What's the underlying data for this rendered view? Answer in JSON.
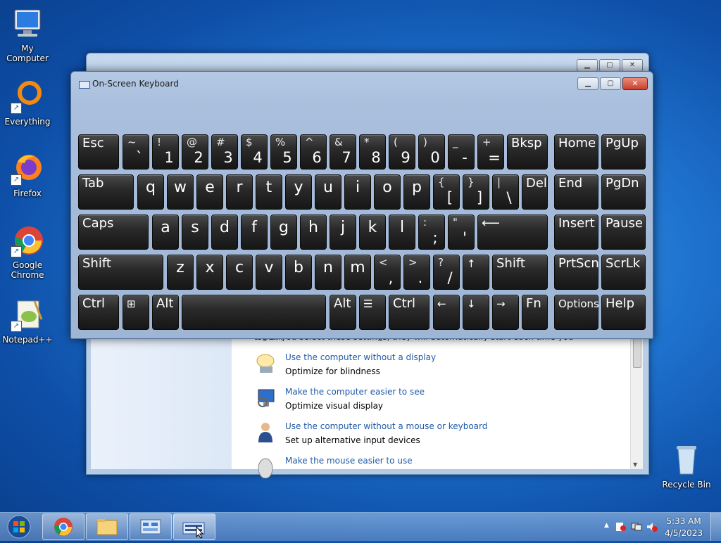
{
  "desktop": {
    "icons": [
      {
        "label": "My Computer",
        "icon": "computer-icon"
      },
      {
        "label": "Everything",
        "icon": "everything-icon"
      },
      {
        "label": "Firefox",
        "icon": "firefox-icon"
      },
      {
        "label": "Google Chrome",
        "icon": "chrome-icon"
      },
      {
        "label": "Notepad++",
        "icon": "notepadpp-icon"
      },
      {
        "label": "Recycle Bin",
        "icon": "recycle-bin-icon"
      }
    ]
  },
  "control_panel": {
    "intro_text": "When you select these settings, they will automatically start each time you log on.",
    "options": [
      {
        "link": "Use the computer without a display",
        "desc": "Optimize for blindness",
        "icon": "narrator-icon"
      },
      {
        "link": "Make the computer easier to see",
        "desc": "Optimize visual display",
        "icon": "monitor-icon"
      },
      {
        "link": "Use the computer without a mouse or keyboard",
        "desc": "Set up alternative input devices",
        "icon": "person-icon"
      },
      {
        "link": "Make the mouse easier to use",
        "desc": "",
        "icon": "mouse-icon"
      }
    ]
  },
  "osk": {
    "title": "On-Screen Keyboard",
    "keys": {
      "esc": "Esc",
      "bksp": "Bksp",
      "home": "Home",
      "pgup": "PgUp",
      "tab": "Tab",
      "del": "Del",
      "end": "End",
      "pgdn": "PgDn",
      "caps": "Caps",
      "enter": "⟵",
      "insert": "Insert",
      "pause": "Pause",
      "shift_l": "Shift",
      "shift_r": "Shift",
      "up": "↑",
      "prtscn": "PrtScn",
      "scrlk": "ScrLk",
      "ctrl_l": "Ctrl",
      "win": "⊞",
      "alt_l": "Alt",
      "alt_r": "Alt",
      "menu": "☰",
      "ctrl_r": "Ctrl",
      "left": "←",
      "down": "↓",
      "right": "→",
      "fn": "Fn",
      "options": "Options",
      "help": "Help"
    },
    "row1": [
      [
        "~",
        "`"
      ],
      [
        "!",
        "1"
      ],
      [
        "@",
        "2"
      ],
      [
        "#",
        "3"
      ],
      [
        "$",
        "4"
      ],
      [
        "%",
        "5"
      ],
      [
        "^",
        "6"
      ],
      [
        "&",
        "7"
      ],
      [
        "*",
        "8"
      ],
      [
        "(",
        "9"
      ],
      [
        ")",
        "0"
      ],
      [
        "_",
        "-"
      ],
      [
        "+",
        "="
      ]
    ],
    "row2": [
      "q",
      "w",
      "e",
      "r",
      "t",
      "y",
      "u",
      "i",
      "o",
      "p"
    ],
    "row2_sym": [
      [
        "{",
        "["
      ],
      [
        "}",
        "]"
      ],
      [
        "|",
        "\\"
      ]
    ],
    "row3": [
      "a",
      "s",
      "d",
      "f",
      "g",
      "h",
      "j",
      "k",
      "l"
    ],
    "row3_sym": [
      [
        ":",
        ";"
      ],
      [
        "\"",
        "'"
      ]
    ],
    "row4": [
      "z",
      "x",
      "c",
      "v",
      "b",
      "n",
      "m"
    ],
    "row4_sym": [
      [
        "<",
        ","
      ],
      [
        ">",
        "."
      ],
      [
        "?",
        "/"
      ]
    ]
  },
  "taskbar": {
    "clock_time": "5:33 AM",
    "clock_date": "4/5/2023",
    "tray_chevron": "▲"
  }
}
